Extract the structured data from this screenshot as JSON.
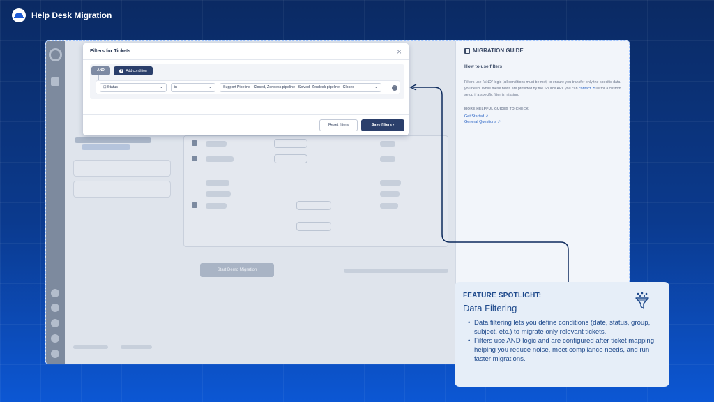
{
  "brand": {
    "name": "Help Desk Migration"
  },
  "dialog": {
    "title": "Filters for Tickets",
    "and_label": "AND",
    "add_condition": "Add condition",
    "condition": {
      "field": "Status",
      "operator": "in",
      "value": "Support Pipeline - Closed, Zendesk pipeline - Solved, Zendesk pipeline - Closed"
    },
    "reset_label": "Reset filters",
    "save_label": "Save filters"
  },
  "guide": {
    "title": "MIGRATION GUIDE",
    "subtitle": "How to use filters",
    "body_before": "Filters use \"AND\" logic (all conditions must be met) to ensure you transfer only the specific data you need. While these fields are provided by the Source API, you can ",
    "contact": "contact",
    "body_after": " us for a custom setup if a specific filter is missing.",
    "more_heading": "MORE HELPFUL GUIDES TO CHECK",
    "links": [
      "Get Started",
      "General Questions"
    ]
  },
  "background_app": {
    "start_button": "Start Demo Migration"
  },
  "spotlight": {
    "kicker": "FEATURE SPOTLIGHT:",
    "title": "Data Filtering",
    "bullets": [
      "Data filtering lets you define conditions (date, status, group, subject, etc.) to migrate only relevant tickets.",
      "Filters use AND logic and are configured after ticket mapping, helping you reduce noise, meet compliance needs, and run faster migrations."
    ]
  },
  "colors": {
    "accent": "#2b3f6b",
    "link": "#2a64c5",
    "connector": "#0d2a5c"
  }
}
